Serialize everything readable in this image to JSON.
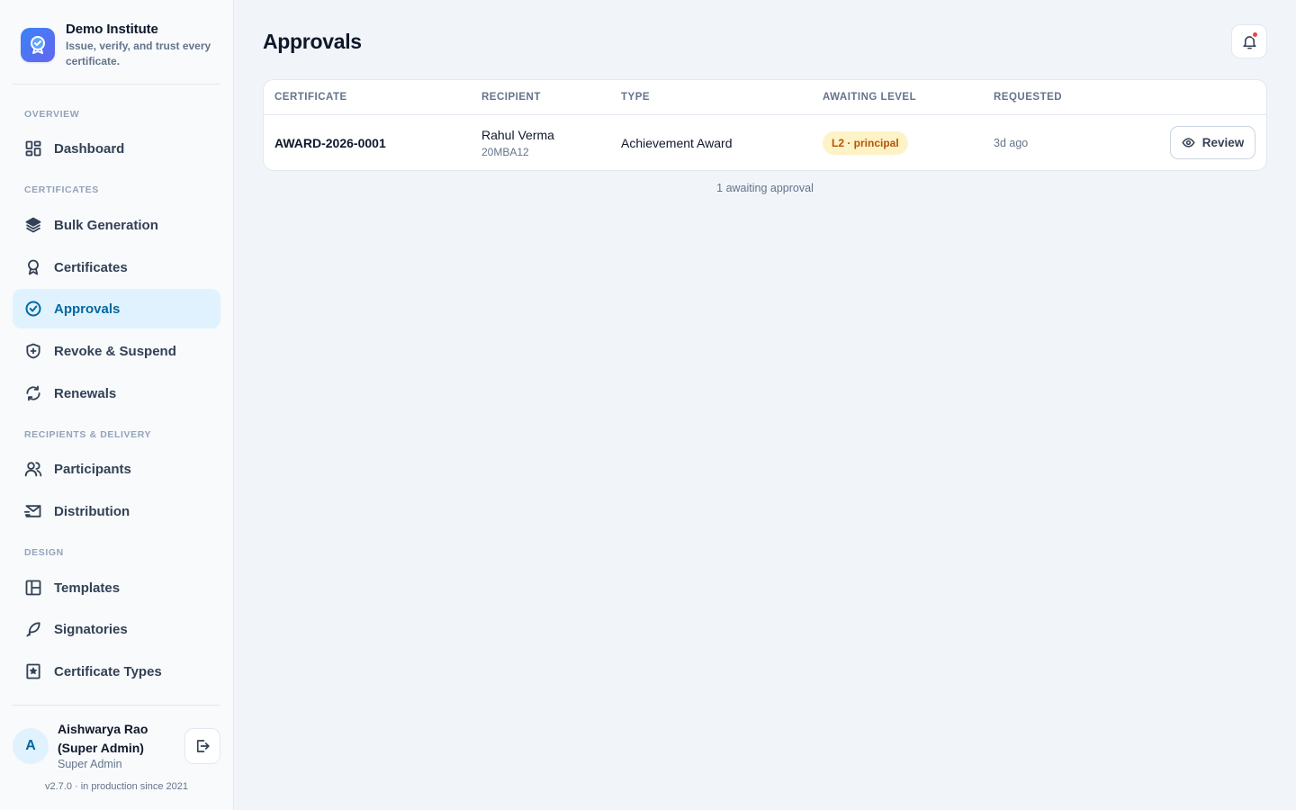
{
  "brand": {
    "title": "Demo Institute",
    "subtitle": "Issue, verify, and trust every certificate."
  },
  "sidebar": {
    "sections": {
      "overview": "OVERVIEW",
      "certificates": "CERTIFICATES",
      "recipients": "RECIPIENTS & DELIVERY",
      "design": "DESIGN"
    },
    "items": {
      "dashboard": "Dashboard",
      "bulk_generation": "Bulk Generation",
      "certificates": "Certificates",
      "approvals": "Approvals",
      "revoke_suspend": "Revoke & Suspend",
      "renewals": "Renewals",
      "participants": "Participants",
      "distribution": "Distribution",
      "templates": "Templates",
      "signatories": "Signatories",
      "certificate_types": "Certificate Types"
    },
    "active": "approvals"
  },
  "user": {
    "initial": "A",
    "name": "Aishwarya Rao (Super Admin)",
    "role": "Super Admin"
  },
  "version": "v2.7.0 · in production since 2021",
  "header": {
    "title": "Approvals",
    "notification_icon": "bell-icon"
  },
  "table": {
    "columns": [
      "CERTIFICATE",
      "RECIPIENT",
      "TYPE",
      "AWAITING LEVEL",
      "REQUESTED"
    ],
    "rows": [
      {
        "certificate": "AWARD-2026-0001",
        "recipient_name": "Rahul Verma",
        "recipient_id": "20MBA12",
        "type": "Achievement Award",
        "awaiting_level": "L2 · principal",
        "requested": "3d ago",
        "action": "Review"
      }
    ]
  },
  "summary": "1 awaiting approval",
  "colors": {
    "accent": "#0369a1",
    "active_bg": "#e0f2fe",
    "badge_bg": "#fef3c7",
    "badge_text": "#b45309",
    "notification_dot": "#ef4444"
  }
}
